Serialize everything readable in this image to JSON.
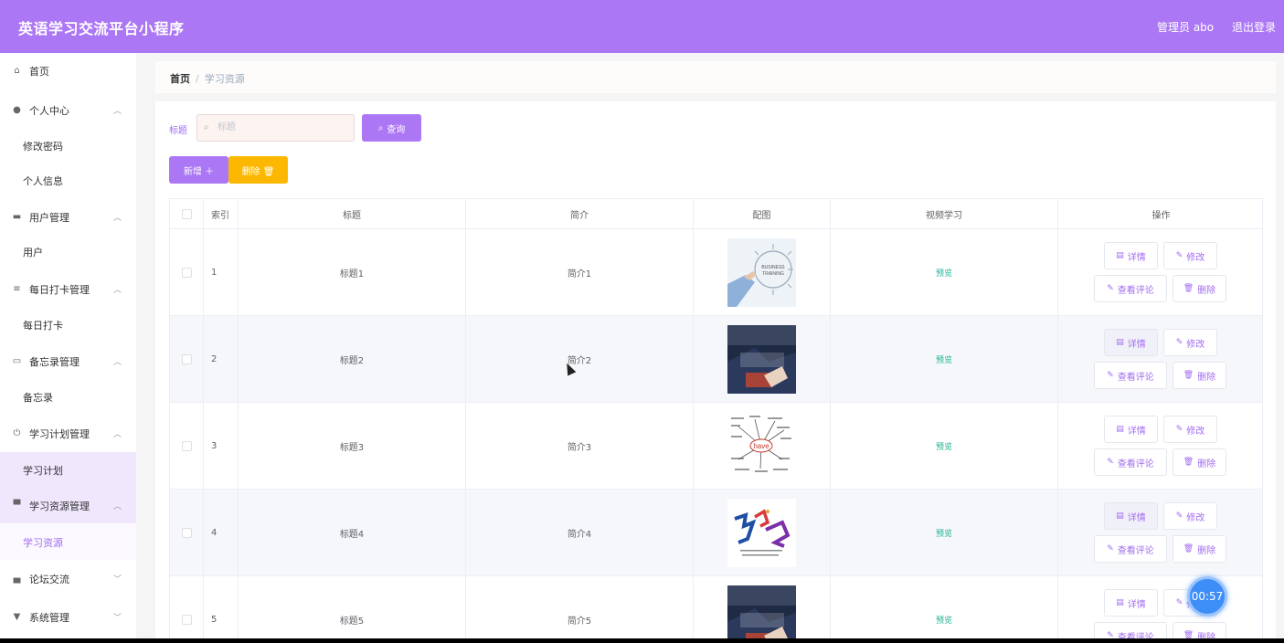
{
  "app": {
    "title": "英语学习交流平台小程序"
  },
  "header": {
    "user": "管理员 abo",
    "logout": "退出登录"
  },
  "sidebar": {
    "items": [
      {
        "label": "首页",
        "icon": "home-icon"
      },
      {
        "label": "个人中心",
        "icon": "user-icon"
      },
      {
        "label": "修改密码"
      },
      {
        "label": "个人信息"
      },
      {
        "label": "用户管理",
        "icon": "users-icon"
      },
      {
        "label": "用户"
      },
      {
        "label": "每日打卡管理",
        "icon": "list-icon"
      },
      {
        "label": "每日打卡"
      },
      {
        "label": "备忘录管理",
        "icon": "memo-icon"
      },
      {
        "label": "备忘录"
      },
      {
        "label": "学习计划管理",
        "icon": "power-icon"
      },
      {
        "label": "学习计划"
      },
      {
        "label": "学习资源管理",
        "icon": "book-icon"
      },
      {
        "label": "学习资源"
      },
      {
        "label": "论坛交流",
        "icon": "forum-icon"
      },
      {
        "label": "系统管理",
        "icon": "system-icon"
      }
    ]
  },
  "breadcrumb": {
    "home": "首页",
    "sep": "/",
    "current": "学习资源"
  },
  "search": {
    "label": "标题",
    "placeholder": "标题",
    "button": "查询"
  },
  "actions": {
    "add": "新增 ＋",
    "delete": "删除 🗑"
  },
  "table": {
    "headers": [
      "索引",
      "标题",
      "简介",
      "配图",
      "视频学习",
      "操作"
    ],
    "rows": [
      {
        "index": "1",
        "title": "标题1",
        "intro": "简介1",
        "video": "预览"
      },
      {
        "index": "2",
        "title": "标题2",
        "intro": "简介2",
        "video": "预览"
      },
      {
        "index": "3",
        "title": "标题3",
        "intro": "简介3",
        "video": "预览"
      },
      {
        "index": "4",
        "title": "标题4",
        "intro": "简介4",
        "video": "预览"
      },
      {
        "index": "5",
        "title": "标题5",
        "intro": "简介5",
        "video": "预览"
      }
    ],
    "ops": {
      "detail": "详情",
      "edit": "修改",
      "comment": "查看评论",
      "remove": "删除"
    }
  },
  "timer": "00:57",
  "colors": {
    "brand": "#ac77f4",
    "delete": "#fcb800",
    "preview": "#1bb394"
  }
}
